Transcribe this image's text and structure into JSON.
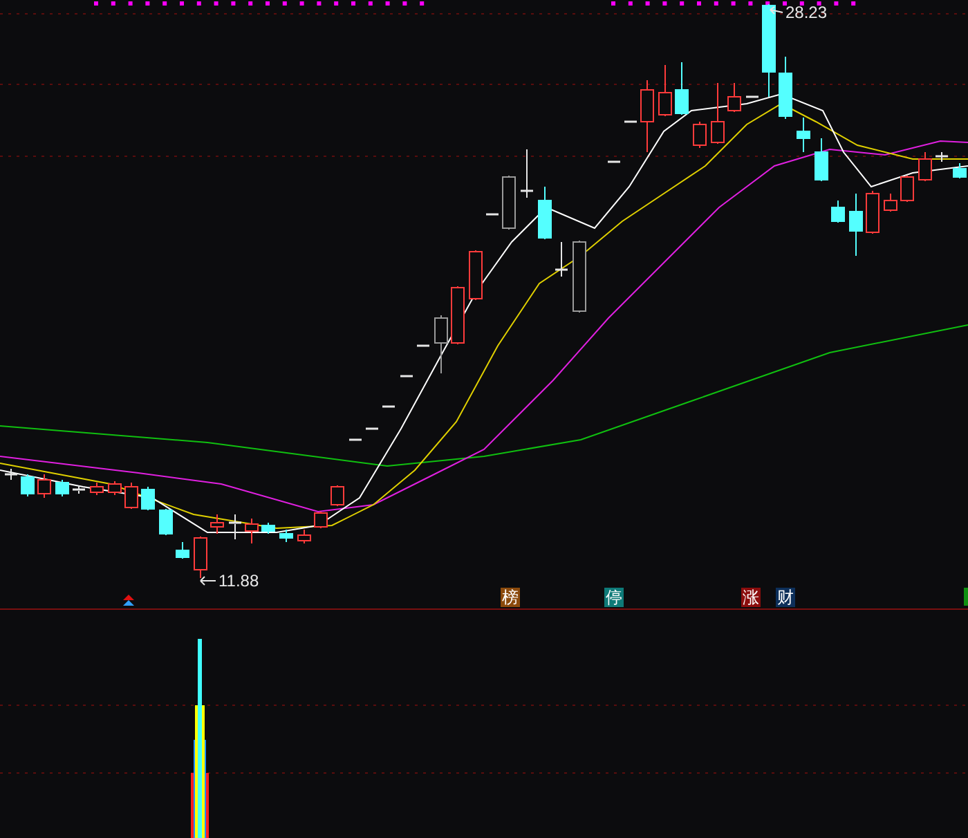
{
  "high_label": "28.23",
  "low_label": "11.88",
  "event_tags": [
    {
      "label": "榜",
      "color": "#8b4a0c"
    },
    {
      "label": "停",
      "color": "#0e7a78"
    },
    {
      "label": "涨",
      "color": "#8b0d0d"
    },
    {
      "label": "财",
      "color": "#0d2f5a"
    }
  ]
}
